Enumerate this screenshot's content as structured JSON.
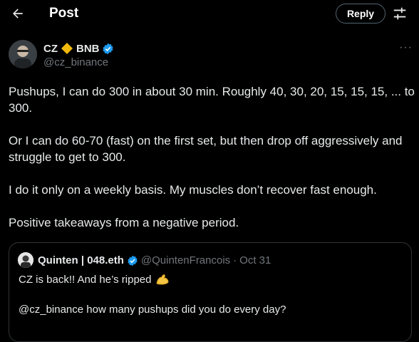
{
  "header": {
    "title": "Post",
    "reply_label": "Reply",
    "icons": {
      "back": "arrow-left-icon",
      "filter": "settings-sliders-icon"
    }
  },
  "post": {
    "author_name": "CZ",
    "author_suffix": "BNB",
    "handle": "@cz_binance",
    "more": "···",
    "text": "Pushups, I can do 300 in about 30 min. Roughly 40, 30, 20, 15, 15, 15, ... to 300.\n\nOr I can do 60-70 (fast) on the first set, but then drop off aggressively and struggle to get to 300.\n\nI do it only on a weekly basis. My muscles don’t recover fast enough.\n\nPositive takeaways from a negative period.",
    "colors": {
      "diamond": "#f0b90b",
      "verified": "#1d9bf0"
    }
  },
  "quoted_post": {
    "author_name": "Quinten | 048.eth",
    "handle": "@QuintenFrancois",
    "separator": "·",
    "date": "Oct 31",
    "line1": "CZ is back!! And he’s ripped",
    "line1_emoji": "flexed-biceps-icon",
    "line2": "@cz_binance how many pushups did you do every day?"
  }
}
